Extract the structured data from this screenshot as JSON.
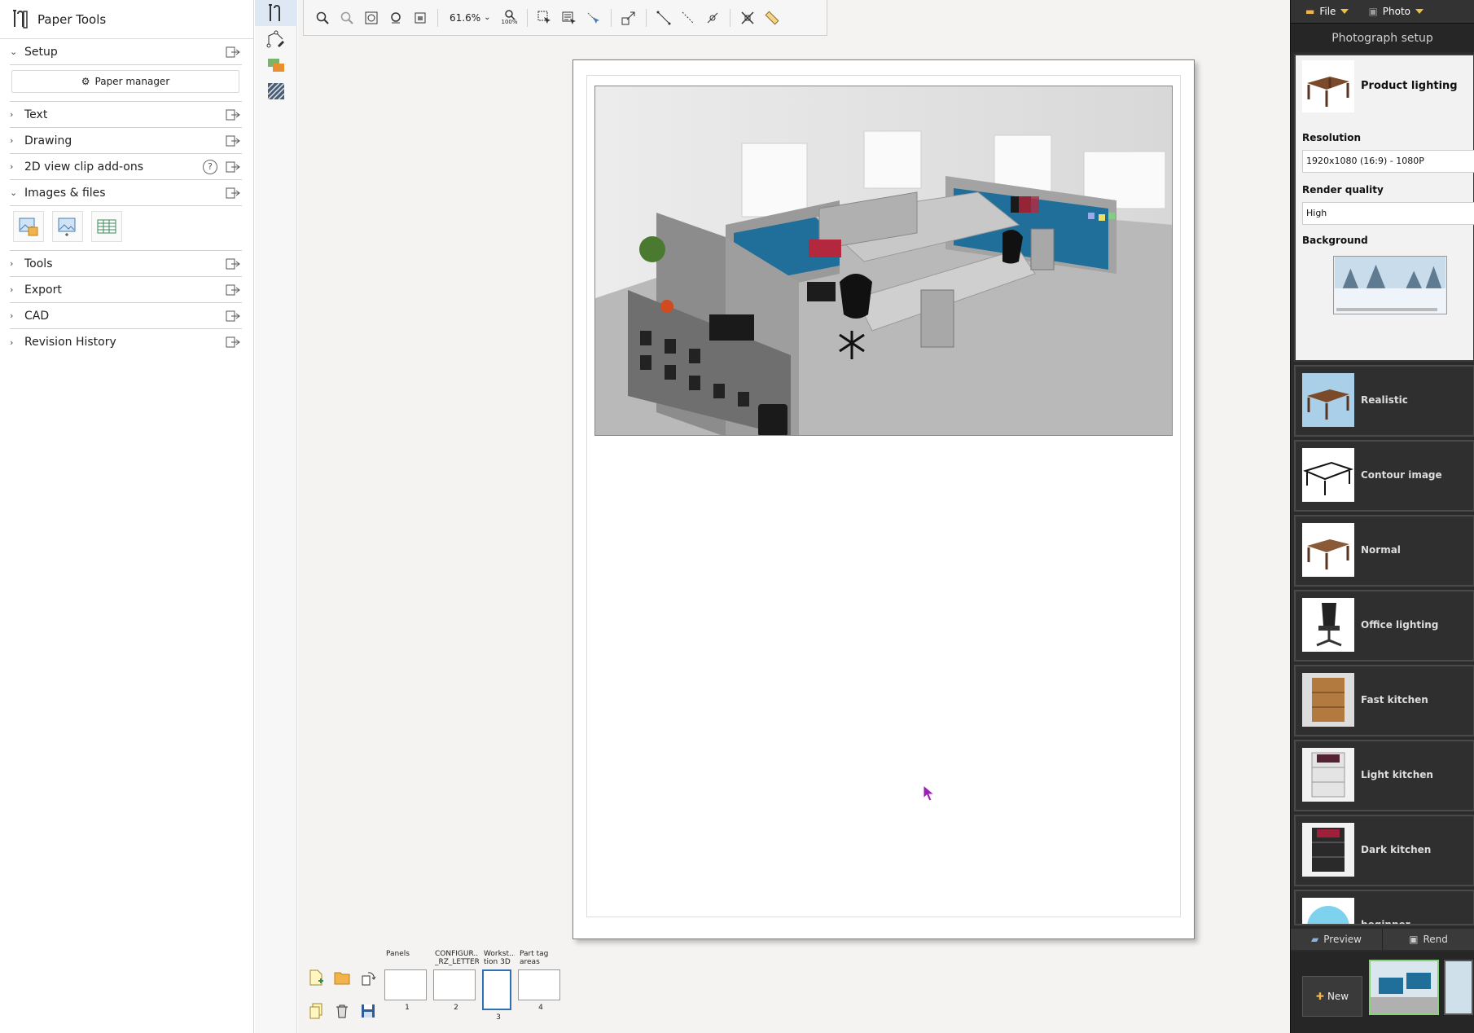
{
  "left_panel": {
    "title": "Paper Tools",
    "sections": [
      {
        "label": "Setup",
        "expanded": true
      },
      {
        "label": "Text",
        "expanded": false
      },
      {
        "label": "Drawing",
        "expanded": false
      },
      {
        "label": "2D view clip add-ons",
        "expanded": false,
        "has_help": true
      },
      {
        "label": "Images & files",
        "expanded": true
      },
      {
        "label": "Tools",
        "expanded": false
      },
      {
        "label": "Export",
        "expanded": false
      },
      {
        "label": "CAD",
        "expanded": false
      },
      {
        "label": "Revision History",
        "expanded": false
      }
    ],
    "paper_manager_label": "Paper manager",
    "help_glyph": "?"
  },
  "toolbar": {
    "zoom_value": "61.6%",
    "zoom_100_label": "100%"
  },
  "page_thumbs": [
    {
      "title": "Panels",
      "number": "1"
    },
    {
      "title": "CONFIGUR... _RZ_LETTER",
      "number": "2"
    },
    {
      "title": "Workst... tion 3D",
      "number": "3",
      "selected": true
    },
    {
      "title": "Part tag areas",
      "number": "4"
    }
  ],
  "right_panel": {
    "menus": [
      "File",
      "Photo"
    ],
    "title": "Photograph setup",
    "setup": {
      "name": "Product lighting",
      "resolution_label": "Resolution",
      "resolution_value": "1920x1080 (16:9) - 1080P",
      "quality_label": "Render quality",
      "quality_value": "High",
      "background_label": "Background"
    },
    "presets": [
      {
        "name": "Realistic",
        "icon": "table-icon"
      },
      {
        "name": "Contour image",
        "icon": "table-outline-icon"
      },
      {
        "name": "Normal",
        "icon": "table-icon"
      },
      {
        "name": "Office lighting",
        "icon": "office-chair-icon"
      },
      {
        "name": "Fast kitchen",
        "icon": "kitchen-cabinet-icon"
      },
      {
        "name": "Light kitchen",
        "icon": "kitchen-cabinet-icon"
      },
      {
        "name": "Dark kitchen",
        "icon": "kitchen-cabinet-icon"
      },
      {
        "name": "beginner",
        "icon": "sphere-icon"
      }
    ],
    "bottom_tabs": [
      "Preview",
      "Rend"
    ],
    "new_label": "New"
  },
  "colors": {
    "accent_blue": "#2f6fb5",
    "panel_dark": "#2b2b2b",
    "cubicle_fabric": "#1f6f9a"
  }
}
